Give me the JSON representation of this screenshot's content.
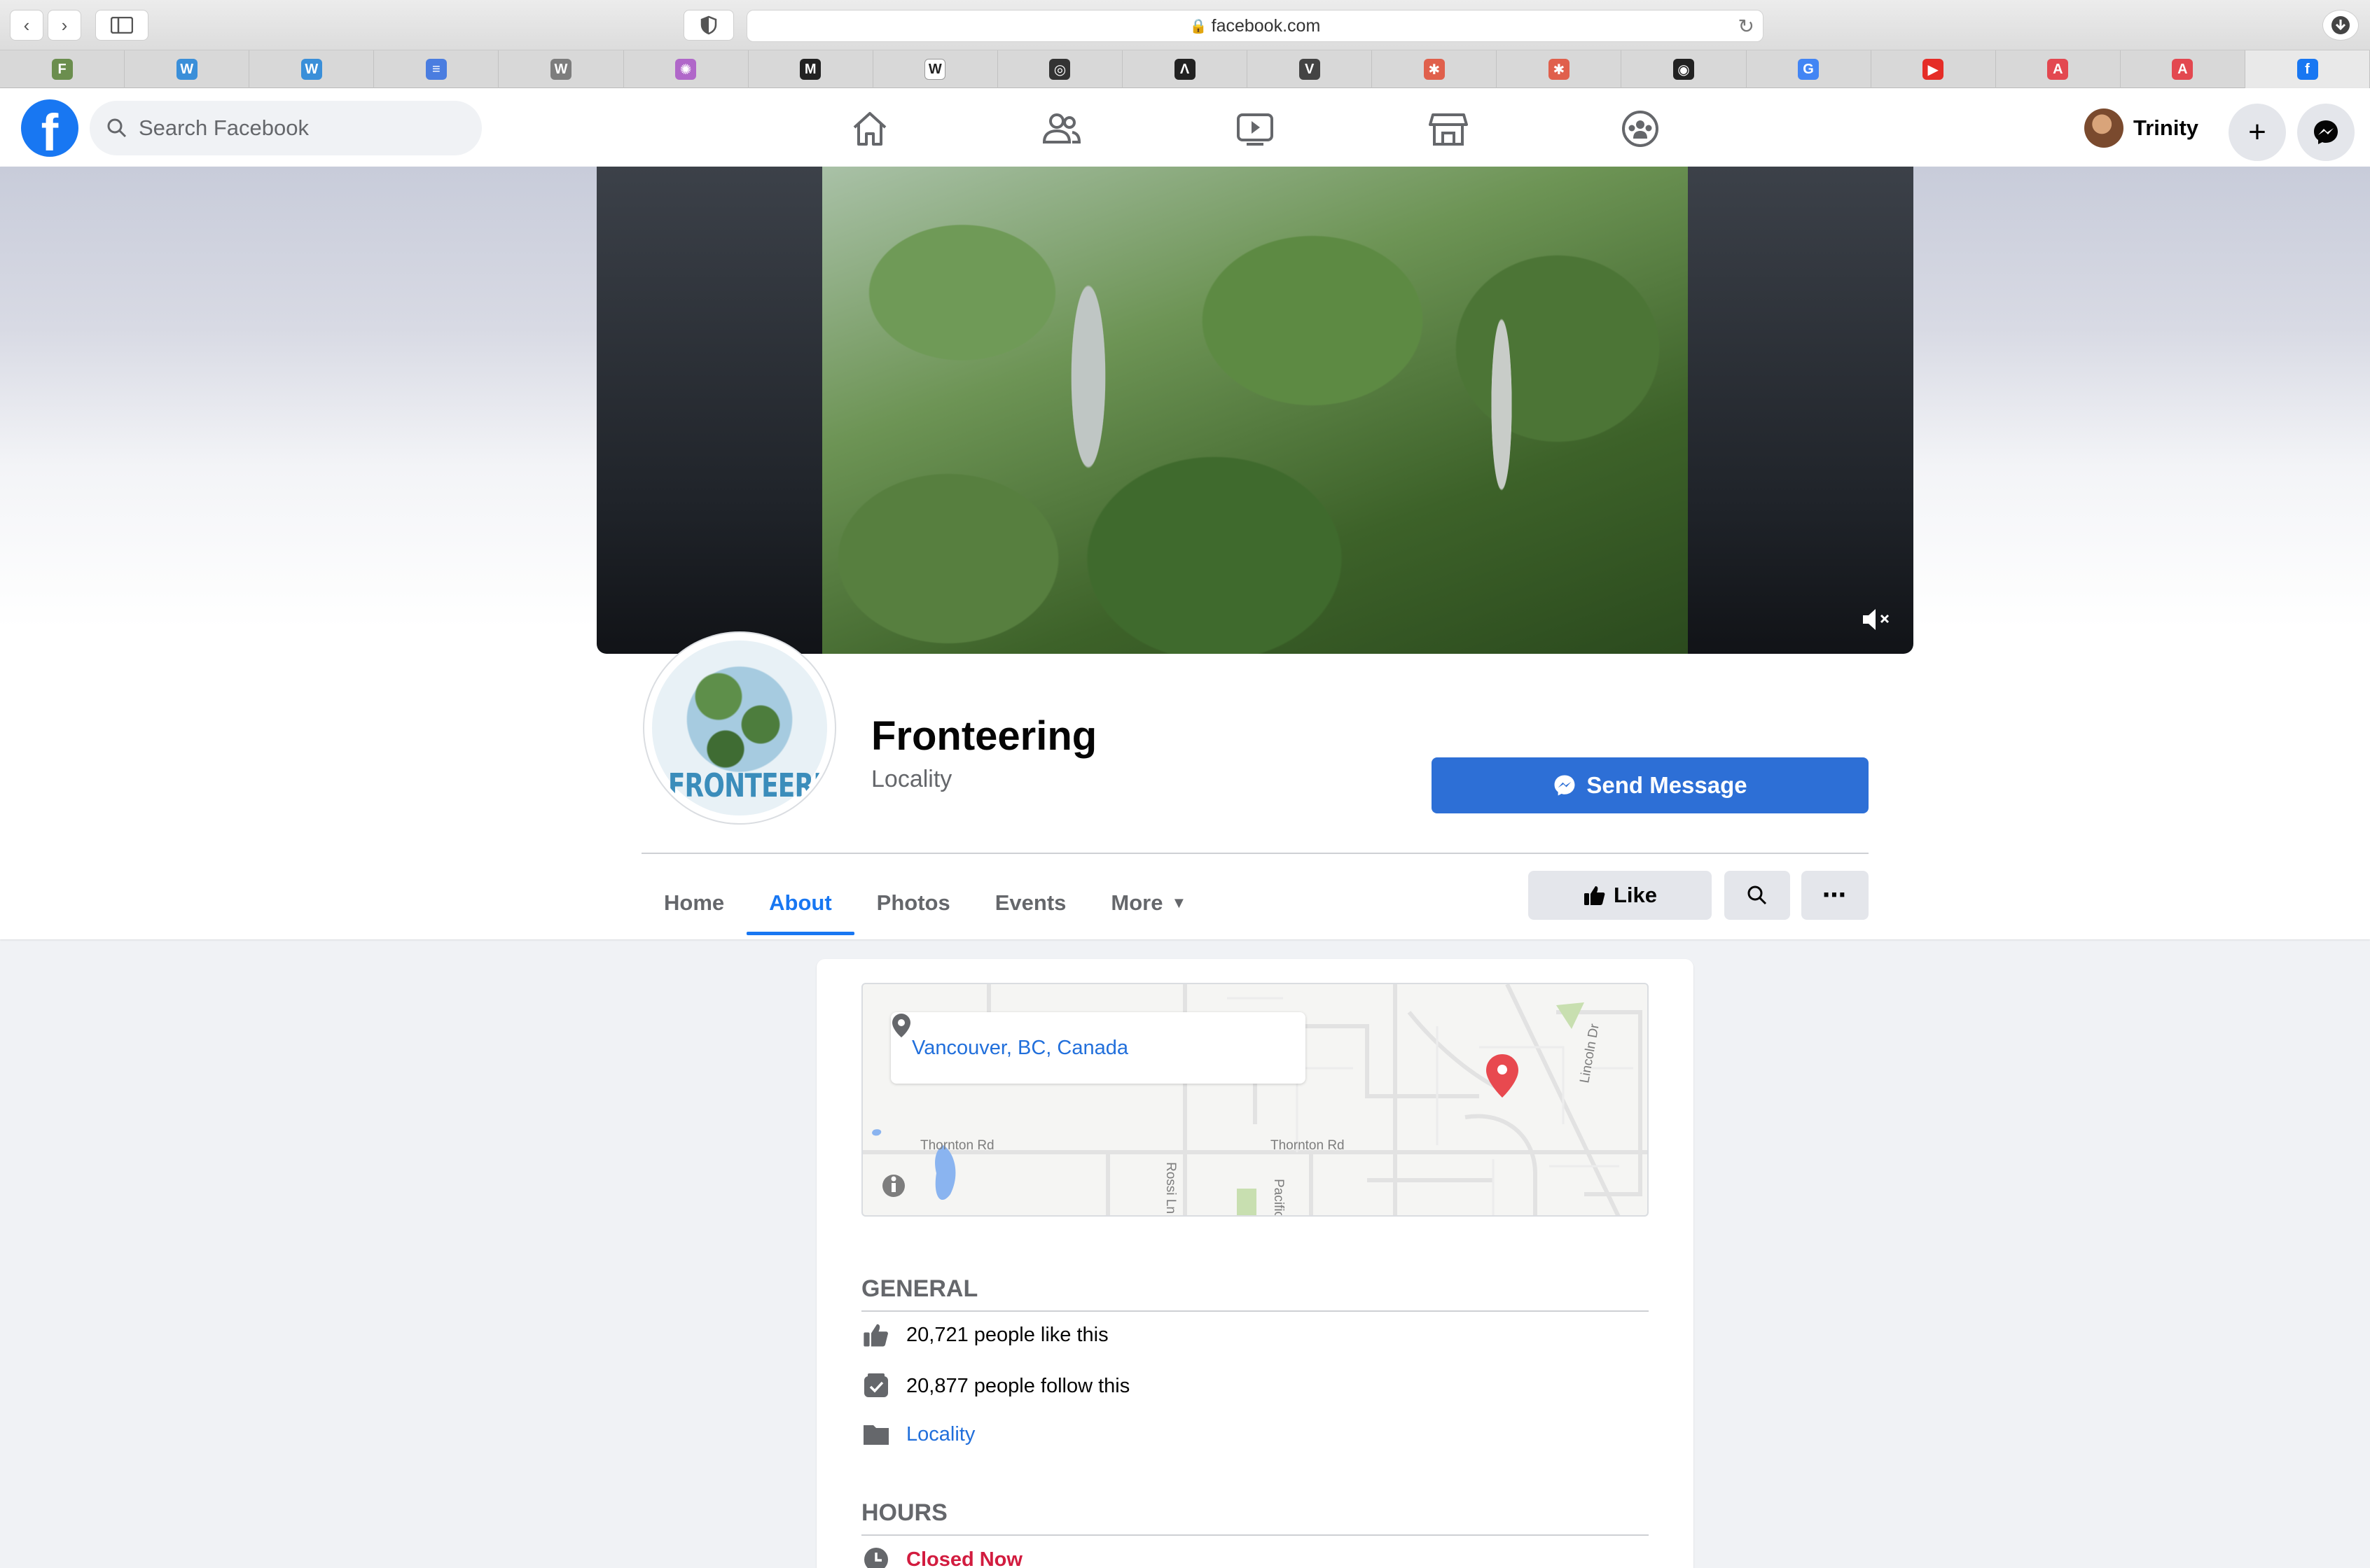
{
  "browser": {
    "url": "facebook.com",
    "favorites": [
      {
        "icon": "stock-icon",
        "glyph": "F",
        "color": "#6b8e4e"
      },
      {
        "icon": "wordpress-icon",
        "glyph": "W",
        "color": "#3a8fd9"
      },
      {
        "icon": "wordpress-icon",
        "glyph": "W",
        "color": "#3a8fd9"
      },
      {
        "icon": "google-docs-icon",
        "glyph": "≡",
        "color": "#4a7de0"
      },
      {
        "icon": "w-app-icon",
        "glyph": "W",
        "color": "#7d7d7d"
      },
      {
        "icon": "colorwheel-icon",
        "glyph": "✺",
        "color": "#b067c9"
      },
      {
        "icon": "medium-icon",
        "glyph": "M",
        "color": "#222222"
      },
      {
        "icon": "wikipedia-icon",
        "glyph": "W",
        "color": "#ffffff"
      },
      {
        "icon": "instagram-icon",
        "glyph": "◎",
        "color": "#333333"
      },
      {
        "icon": "a-app-icon",
        "glyph": "Λ",
        "color": "#222222"
      },
      {
        "icon": "v-app-icon",
        "glyph": "V",
        "color": "#444444"
      },
      {
        "icon": "asana-icon",
        "glyph": "✱",
        "color": "#e0604c"
      },
      {
        "icon": "asana-icon",
        "glyph": "✱",
        "color": "#e0604c"
      },
      {
        "icon": "github-icon",
        "glyph": "◉",
        "color": "#222222"
      },
      {
        "icon": "google-icon",
        "glyph": "G",
        "color": "#4285f4"
      },
      {
        "icon": "youtube-icon",
        "glyph": "▶",
        "color": "#e52d27"
      },
      {
        "icon": "adobe-icon",
        "glyph": "A",
        "color": "#e34850"
      },
      {
        "icon": "adobe-icon",
        "glyph": "A",
        "color": "#e34850"
      },
      {
        "icon": "facebook-icon",
        "glyph": "f",
        "color": "#1877f2"
      }
    ]
  },
  "fbnav": {
    "search_placeholder": "Search Facebook",
    "user_name": "Trinity"
  },
  "page": {
    "title": "Fronteering",
    "category": "Locality",
    "send_message": "Send Message",
    "avatar_text": "FRONTEERING",
    "tabs": [
      "Home",
      "About",
      "Photos",
      "Events",
      "More"
    ],
    "active_tab": "About",
    "like_label": "Like"
  },
  "about": {
    "location": "Vancouver, BC, Canada",
    "map_labels": {
      "road1": "Thornton Rd",
      "road2": "Thornton Rd",
      "road3": "Rossi Ln",
      "road4": "Pacific",
      "road5": "Lincoln Dr"
    },
    "general_heading": "GENERAL",
    "likes": "20,721 people like this",
    "follows": "20,877 people follow this",
    "category_link": "Locality",
    "hours_heading": "HOURS",
    "hours_status": "Closed Now"
  },
  "colors": {
    "fb_blue": "#1877f2",
    "send_button": "#2d6fd6",
    "link": "#216fdb",
    "closed": "#d21c3f"
  }
}
